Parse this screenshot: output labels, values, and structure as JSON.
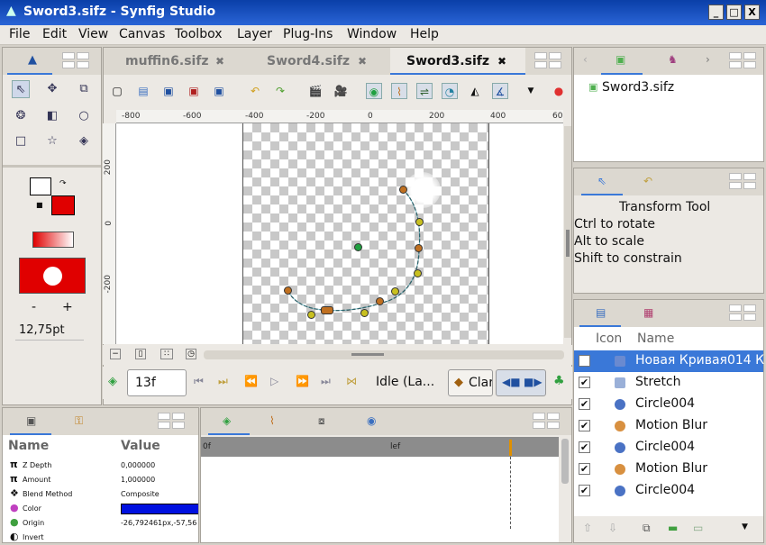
{
  "window": {
    "title": "Sword3.sifz - Synfig Studio",
    "min": "_",
    "max": "□",
    "close": "X"
  },
  "menu": [
    "File",
    "Edit",
    "View",
    "Canvas",
    "Toolbox",
    "Layer",
    "Plug-Ins",
    "Window",
    "Help"
  ],
  "doc_tabs": [
    {
      "label": "muffin6.sifz",
      "close": "✖"
    },
    {
      "label": "Sword4.sifz",
      "close": "✖"
    },
    {
      "label": "Sword3.sifz",
      "close": "✖",
      "active": true
    }
  ],
  "ruler_h": [
    "-800",
    "-600",
    "-400",
    "-200",
    "0",
    "200",
    "400",
    "60"
  ],
  "ruler_v": [
    "200",
    "0",
    "-200"
  ],
  "toolbox": {
    "width_value": "12,75pt",
    "minus": "-",
    "plus": "+"
  },
  "timebar": {
    "frame": "13f",
    "state": "Idle (La...",
    "clamp": "Clar"
  },
  "canvas_browser": {
    "file": "Sword3.sifz"
  },
  "tool_options": {
    "title": "Transform Tool",
    "lines": [
      "Ctrl to rotate",
      "Alt to scale",
      "Shift to constrain"
    ]
  },
  "layers": {
    "col_icon": "Icon",
    "col_name": "Name",
    "rows": [
      {
        "name": "Новая Кривая014 К",
        "checked": false,
        "selected": true,
        "color": "#6a8ad0"
      },
      {
        "name": "Stretch",
        "checked": true,
        "color": "#9ab0d8"
      },
      {
        "name": "Circle004",
        "checked": true,
        "color": "#4a72c4"
      },
      {
        "name": "Motion Blur",
        "checked": true,
        "color": "#d89040"
      },
      {
        "name": "Circle004",
        "checked": true,
        "color": "#4a72c4"
      },
      {
        "name": "Motion Blur",
        "checked": true,
        "color": "#d89040"
      },
      {
        "name": "Circle004",
        "checked": true,
        "color": "#4a72c4"
      }
    ]
  },
  "params": {
    "col_name": "Name",
    "col_value": "Value",
    "rows": [
      {
        "icon": "π",
        "name": "Z Depth",
        "value": "0,000000"
      },
      {
        "icon": "π",
        "name": "Amount",
        "value": "1,000000"
      },
      {
        "icon": "❖",
        "name": "Blend Method",
        "value": "Composite"
      },
      {
        "icon": "●",
        "name": "Color",
        "value": ""
      },
      {
        "icon": "●",
        "name": "Origin",
        "value": "-26,792461px,-57,56"
      },
      {
        "icon": "◐",
        "name": "Invert",
        "value": ""
      }
    ]
  },
  "timetrack": {
    "start": "0f",
    "mid": "lef"
  },
  "colors": {
    "title": "#1a50c0",
    "accent": "#e00000",
    "selected": "#3a78d8",
    "color_param": "#0010e0"
  }
}
